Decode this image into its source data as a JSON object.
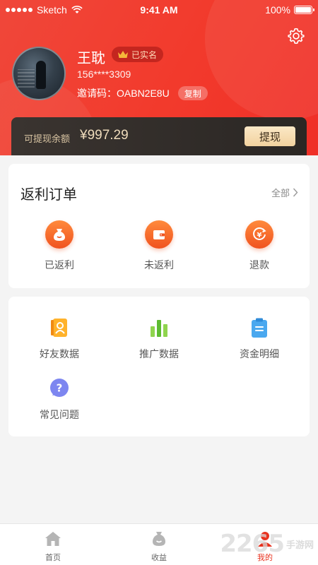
{
  "status_bar": {
    "carrier": "Sketch",
    "time": "9:41 AM",
    "battery": "100%"
  },
  "profile": {
    "name": "王耽",
    "verified_badge": "已实名",
    "phone": "156****3309",
    "invite_label": "邀请码：",
    "invite_code": "OABN2E8U",
    "copy_label": "复制"
  },
  "balance": {
    "label": "可提现余额",
    "value": "¥997.29",
    "withdraw_label": "提现"
  },
  "orders": {
    "title": "返利订单",
    "all_label": "全部",
    "items": [
      {
        "label": "已返利",
        "icon": "money-bag-icon"
      },
      {
        "label": "未返利",
        "icon": "wallet-icon"
      },
      {
        "label": "退款",
        "icon": "refund-yen-icon"
      }
    ]
  },
  "tools": [
    {
      "label": "好友数据",
      "icon": "friend-card-icon"
    },
    {
      "label": "推广数据",
      "icon": "bar-chart-icon"
    },
    {
      "label": "资金明细",
      "icon": "clipboard-icon"
    },
    {
      "label": "常见问题",
      "icon": "question-bubble-icon"
    }
  ],
  "tabbar": [
    {
      "label": "首页",
      "icon": "home-icon"
    },
    {
      "label": "收益",
      "icon": "money-bag-icon"
    },
    {
      "label": "我的",
      "icon": "profile-icon"
    }
  ],
  "watermark": {
    "number": "2265",
    "text": "手游网"
  },
  "colors": {
    "brand_red": "#f23a2c",
    "orange": "#f0521f",
    "gold": "#efdcbc",
    "dark_panel": "#2b2724"
  }
}
